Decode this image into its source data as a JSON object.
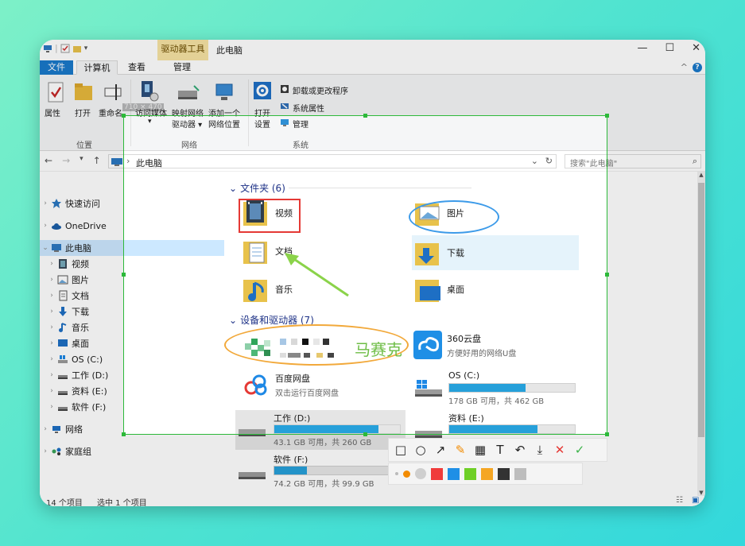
{
  "window": {
    "context_tab": "驱动器工具",
    "title": "此电脑",
    "controls": [
      "—",
      "☐",
      "✕"
    ]
  },
  "tabs": [
    {
      "label": "文件"
    },
    {
      "label": "计算机"
    },
    {
      "label": "查看"
    },
    {
      "label": "管理"
    }
  ],
  "ribbon": {
    "properties": "属性",
    "open": "打开",
    "rename": "重命名",
    "access_media": "访问媒体",
    "map_network_drive_1": "映射网络",
    "map_network_drive_2": "驱动器 ▾",
    "add_location_1": "添加一个",
    "add_location_2": "网络位置",
    "open_settings_1": "打开",
    "open_settings_2": "设置",
    "uninstall": "卸载或更改程序",
    "system_props": "系统属性",
    "manage": "管理",
    "group_location": "位置",
    "group_network": "网络",
    "group_system": "系统"
  },
  "address": {
    "path": "此电脑",
    "search_placeholder": "搜索\"此电脑\""
  },
  "nav": [
    {
      "label": "快速访问",
      "level": 0
    },
    {
      "label": "OneDrive",
      "level": 0
    },
    {
      "label": "此电脑",
      "level": 0
    },
    {
      "label": "视频",
      "level": 1
    },
    {
      "label": "图片",
      "level": 1
    },
    {
      "label": "文档",
      "level": 1
    },
    {
      "label": "下载",
      "level": 1
    },
    {
      "label": "音乐",
      "level": 1
    },
    {
      "label": "桌面",
      "level": 1
    },
    {
      "label": "OS (C:)",
      "level": 1
    },
    {
      "label": "工作 (D:)",
      "level": 1
    },
    {
      "label": "资料 (E:)",
      "level": 1
    },
    {
      "label": "软件 (F:)",
      "level": 1
    },
    {
      "label": "网络",
      "level": 0
    },
    {
      "label": "家庭组",
      "level": 0
    }
  ],
  "folders_header": "文件夹 (6)",
  "folders": [
    "视频",
    "图片",
    "文档",
    "下载",
    "音乐",
    "桌面"
  ],
  "devices_header": "设备和驱动器 (7)",
  "devices": {
    "cloud360_name": "360云盘",
    "cloud360_desc": "方便好用的网络U盘",
    "baidu_name": "百度网盘",
    "baidu_desc": "双击运行百度网盘",
    "drive_c_name": "OS (C:)",
    "drive_c_info": "178 GB 可用，共 462 GB",
    "drive_c_used": 0.61,
    "drive_d_name": "工作 (D:)",
    "drive_d_info": "43.1 GB 可用，共 260 GB",
    "drive_d_used": 0.83,
    "drive_e_name": "资料 (E:)",
    "drive_e_used": 0.7,
    "drive_f_name": "软件 (F:)",
    "drive_f_info": "74.2 GB 可用，共 99.9 GB",
    "drive_f_used": 0.26
  },
  "status": {
    "count": "14 个项目",
    "selected": "选中 1 个项目"
  },
  "overlay": {
    "size_label": "710 × 470",
    "mosaic_text": "马赛克",
    "tools": [
      "□",
      "○",
      "↗",
      "✎",
      "▦",
      "T",
      "↶",
      "⤓",
      "✕",
      "✓"
    ],
    "colors": [
      "#f28b00",
      "#cfcfcf",
      "#f03b3b",
      "#1f8fe6",
      "#6fcf26",
      "#f5a623",
      "#333333",
      "#bdbdbd"
    ],
    "accent": "#2db93a"
  }
}
